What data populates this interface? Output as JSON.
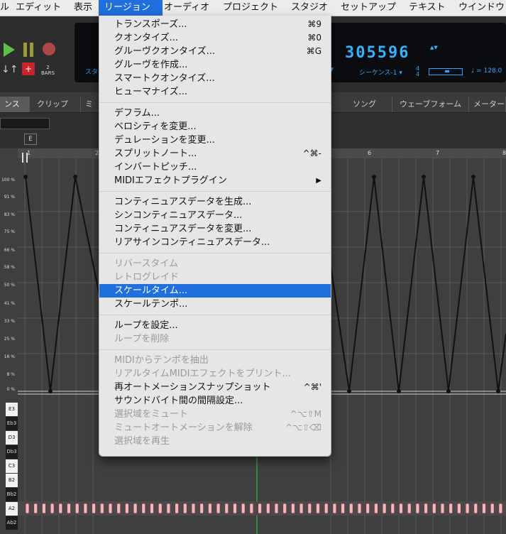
{
  "menubar": {
    "items": [
      "エディット",
      "表示",
      "リージョン",
      "オーディオ",
      "プロジェクト",
      "スタジオ",
      "セットアップ",
      "テキスト",
      "ウインドウ"
    ],
    "partial_first": "ル"
  },
  "transport": {
    "counter": "305596",
    "counter_arrows": "▲▼",
    "bars_value": "2",
    "bars_label": "BARS",
    "lcd_left": "スタ",
    "sequence": "シーケンス-1 ▾",
    "sig_top": "4",
    "sig_bottom": "4",
    "tempo": "♩ = 128.0",
    "meter_position": 0.55
  },
  "tabs": {
    "items": [
      "ンス",
      "クリップ",
      "ミ",
      "ソング",
      "ウェーブフォーム",
      "メーター"
    ]
  },
  "editor": {
    "e_button": "E",
    "ruler": [
      "1",
      "2",
      "6",
      "7",
      "8"
    ],
    "percent_labels": [
      "100 %",
      "91 %",
      "83 %",
      "75 %",
      "66 %",
      "58 %",
      "50 %",
      "41 %",
      "33 %",
      "25 %",
      "16 %",
      "8 %",
      "0 %"
    ],
    "keys": [
      "E3",
      "Eb3",
      "D3",
      "Db3",
      "C3",
      "B2",
      "Bb2",
      "A2",
      "Ab2"
    ],
    "key_types": [
      "white",
      "black",
      "white",
      "black",
      "white",
      "white",
      "black",
      "white",
      "black"
    ]
  },
  "menu": {
    "groups": [
      [
        {
          "label": "トランスポーズ...",
          "shortcut": "⌘9"
        },
        {
          "label": "クオンタイズ...",
          "shortcut": "⌘0"
        },
        {
          "label": "グルーヴクオンタイズ...",
          "shortcut": "⌘G"
        },
        {
          "label": "グルーヴを作成...",
          "shortcut": ""
        },
        {
          "label": "スマートクオンタイズ...",
          "shortcut": ""
        },
        {
          "label": "ヒューマナイズ...",
          "shortcut": ""
        }
      ],
      [
        {
          "label": "デフラム...",
          "shortcut": ""
        },
        {
          "label": "ベロシティを変更...",
          "shortcut": ""
        },
        {
          "label": "デュレーションを変更...",
          "shortcut": ""
        },
        {
          "label": "スプリットノート...",
          "shortcut": "^⌘-"
        },
        {
          "label": "インバートピッチ...",
          "shortcut": ""
        },
        {
          "label": "MIDIエフェクトプラグイン",
          "shortcut": "",
          "submenu": true,
          "arrow": "▶"
        }
      ],
      [
        {
          "label": "コンティニュアスデータを生成...",
          "shortcut": ""
        },
        {
          "label": "シンコンティニュアスデータ...",
          "shortcut": ""
        },
        {
          "label": "コンティニュアスデータを変更...",
          "shortcut": ""
        },
        {
          "label": "リアサインコンティニュアスデータ...",
          "shortcut": ""
        }
      ],
      [
        {
          "label": "リバースタイム",
          "shortcut": "",
          "disabled": true
        },
        {
          "label": "レトログレイド",
          "shortcut": "",
          "disabled": true
        },
        {
          "label": "スケールタイム...",
          "shortcut": "",
          "highlighted": true
        },
        {
          "label": "スケールテンポ...",
          "shortcut": ""
        }
      ],
      [
        {
          "label": "ループを設定...",
          "shortcut": ""
        },
        {
          "label": "ループを削除",
          "shortcut": "",
          "disabled": true
        }
      ],
      [
        {
          "label": "MIDIからテンポを抽出",
          "shortcut": "",
          "disabled": true
        },
        {
          "label": "リアルタイムMIDIエフェクトをプリント...",
          "shortcut": "",
          "disabled": true
        },
        {
          "label": "再オートメーションスナップショット",
          "shortcut": "^⌘'"
        },
        {
          "label": "サウンドバイト間の間隔設定...",
          "shortcut": ""
        },
        {
          "label": "選択域をミュート",
          "shortcut": "^⌥⇧M",
          "disabled": true
        },
        {
          "label": "ミュートオートメーションを解除",
          "shortcut": "^⌥⇧⌫",
          "disabled": true
        },
        {
          "label": "選択域を再生",
          "shortcut": "",
          "disabled": true
        }
      ]
    ]
  }
}
